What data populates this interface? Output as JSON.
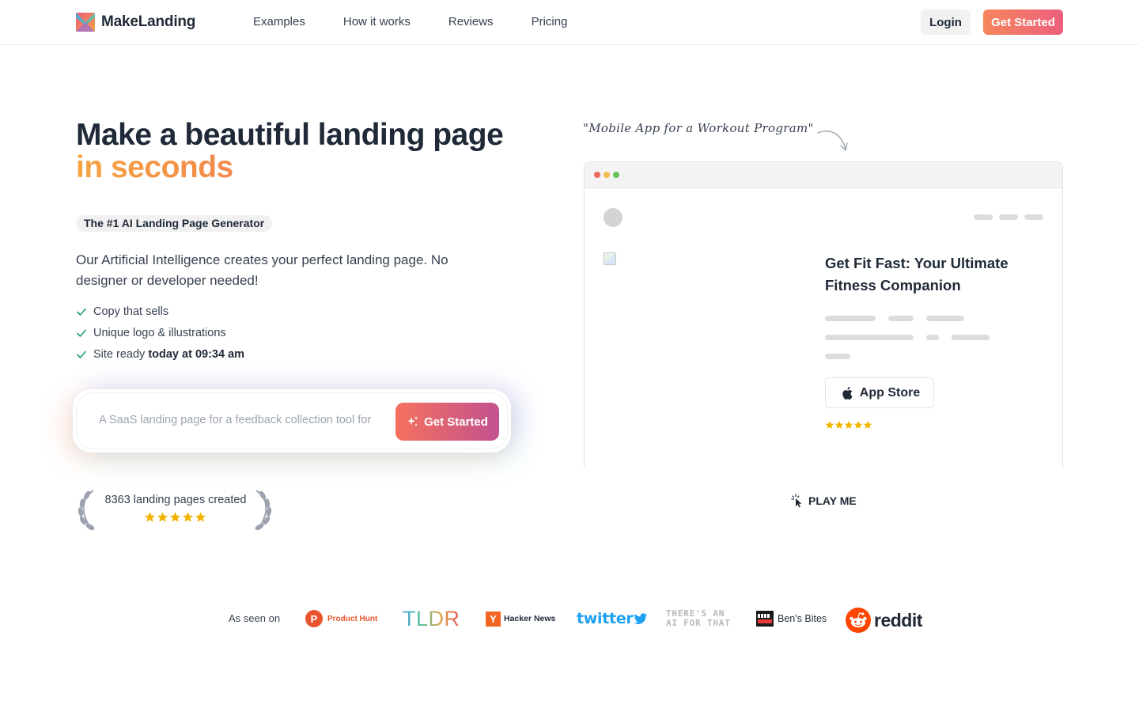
{
  "header": {
    "brand": "MakeLanding",
    "nav": [
      "Examples",
      "How it works",
      "Reviews",
      "Pricing"
    ],
    "login_label": "Login",
    "cta_label": "Get Started"
  },
  "hero": {
    "title_line1": "Make a beautiful landing page",
    "title_line2": "in seconds",
    "badge": "The #1 AI Landing Page Generator",
    "description": "Our Artificial Intelligence creates your perfect landing page. No designer or developer needed!",
    "features": {
      "f1": "Copy that sells",
      "f2": "Unique logo & illustrations",
      "f3_prefix": "Site ready ",
      "f3_bold": "today at 09:34 am"
    },
    "prompt": {
      "placeholder": "A SaaS landing page for a feedback collection tool for",
      "button_label": "Get Started"
    },
    "rating": {
      "text": "8363 landing pages created",
      "stars": 5
    }
  },
  "demo": {
    "quote": "\"Mobile App for a Workout Program\"",
    "title": "Get Fit Fast: Your Ultimate Fitness Companion",
    "store_button": "App Store",
    "stars": 5,
    "play_label": "PLAY ME",
    "colors": {
      "dot_red": "#ee6a5f",
      "dot_yellow": "#f5bd4f",
      "dot_green": "#61c454"
    }
  },
  "press": {
    "label": "As seen on",
    "product_hunt_letter": "P",
    "product_hunt": "Product Hunt",
    "tldr": "TLDR",
    "hacker_news_letter": "Y",
    "hacker_news": "Hacker News",
    "twitter": "twitter",
    "aift_line1": "THERE'S AN",
    "aift_line2": "AI FOR THAT",
    "bens_bites": "Ben's Bites",
    "reddit": "reddit"
  },
  "colors": {
    "accent_start": "#f6865c",
    "accent_end": "#ec5f7e",
    "check": "#22a06b",
    "star": "#f0b400"
  }
}
